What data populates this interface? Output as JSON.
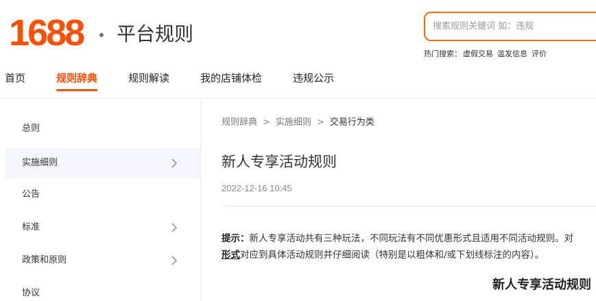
{
  "header": {
    "logo_text": "1688",
    "site_title": "平台规则",
    "search": {
      "placeholder": "搜索规则关键词 如：违规",
      "value": ""
    },
    "hot_search": {
      "label": "热门搜索：",
      "terms": [
        "虚假交易",
        "滥发信息",
        "评价"
      ]
    }
  },
  "nav": {
    "items": [
      "首页",
      "规则辞典",
      "规则解读",
      "我的店铺体检",
      "违规公示"
    ],
    "active": "规则辞典"
  },
  "sidebar": {
    "items": [
      {
        "label": "总则",
        "has_arrow": false
      },
      {
        "label": "实施细则",
        "has_arrow": true,
        "active": true
      },
      {
        "label": "公告",
        "has_arrow": false
      },
      {
        "label": "标准",
        "has_arrow": true
      },
      {
        "label": "政策和原则",
        "has_arrow": true
      },
      {
        "label": "协议",
        "has_arrow": false
      }
    ]
  },
  "breadcrumb": {
    "items": [
      "规则辞典",
      "实施细则",
      "交易行为类"
    ],
    "separator": ">"
  },
  "article": {
    "title": "新人专享活动规则",
    "date": "2022-12-16 10:45",
    "tip": {
      "label": "提示：",
      "text_line1": "新人专享活动共有三种玩法，不同玩法有不同优惠形式且适用不同活动规则。对",
      "text_line2_underlined": "形式",
      "text_line2_rest": "对应到具体活动规则并仔细阅读（特别是以粗体和/或下划线标注的内容）。"
    },
    "section_heading": "新人专享活动规则"
  },
  "colors": {
    "brand": "#ff4f00",
    "search_border": "#ff6a00",
    "sidebar_active_bg": "#f3f6fc"
  },
  "icons": {
    "sidebar_arrow": "chevron-right-icon"
  }
}
